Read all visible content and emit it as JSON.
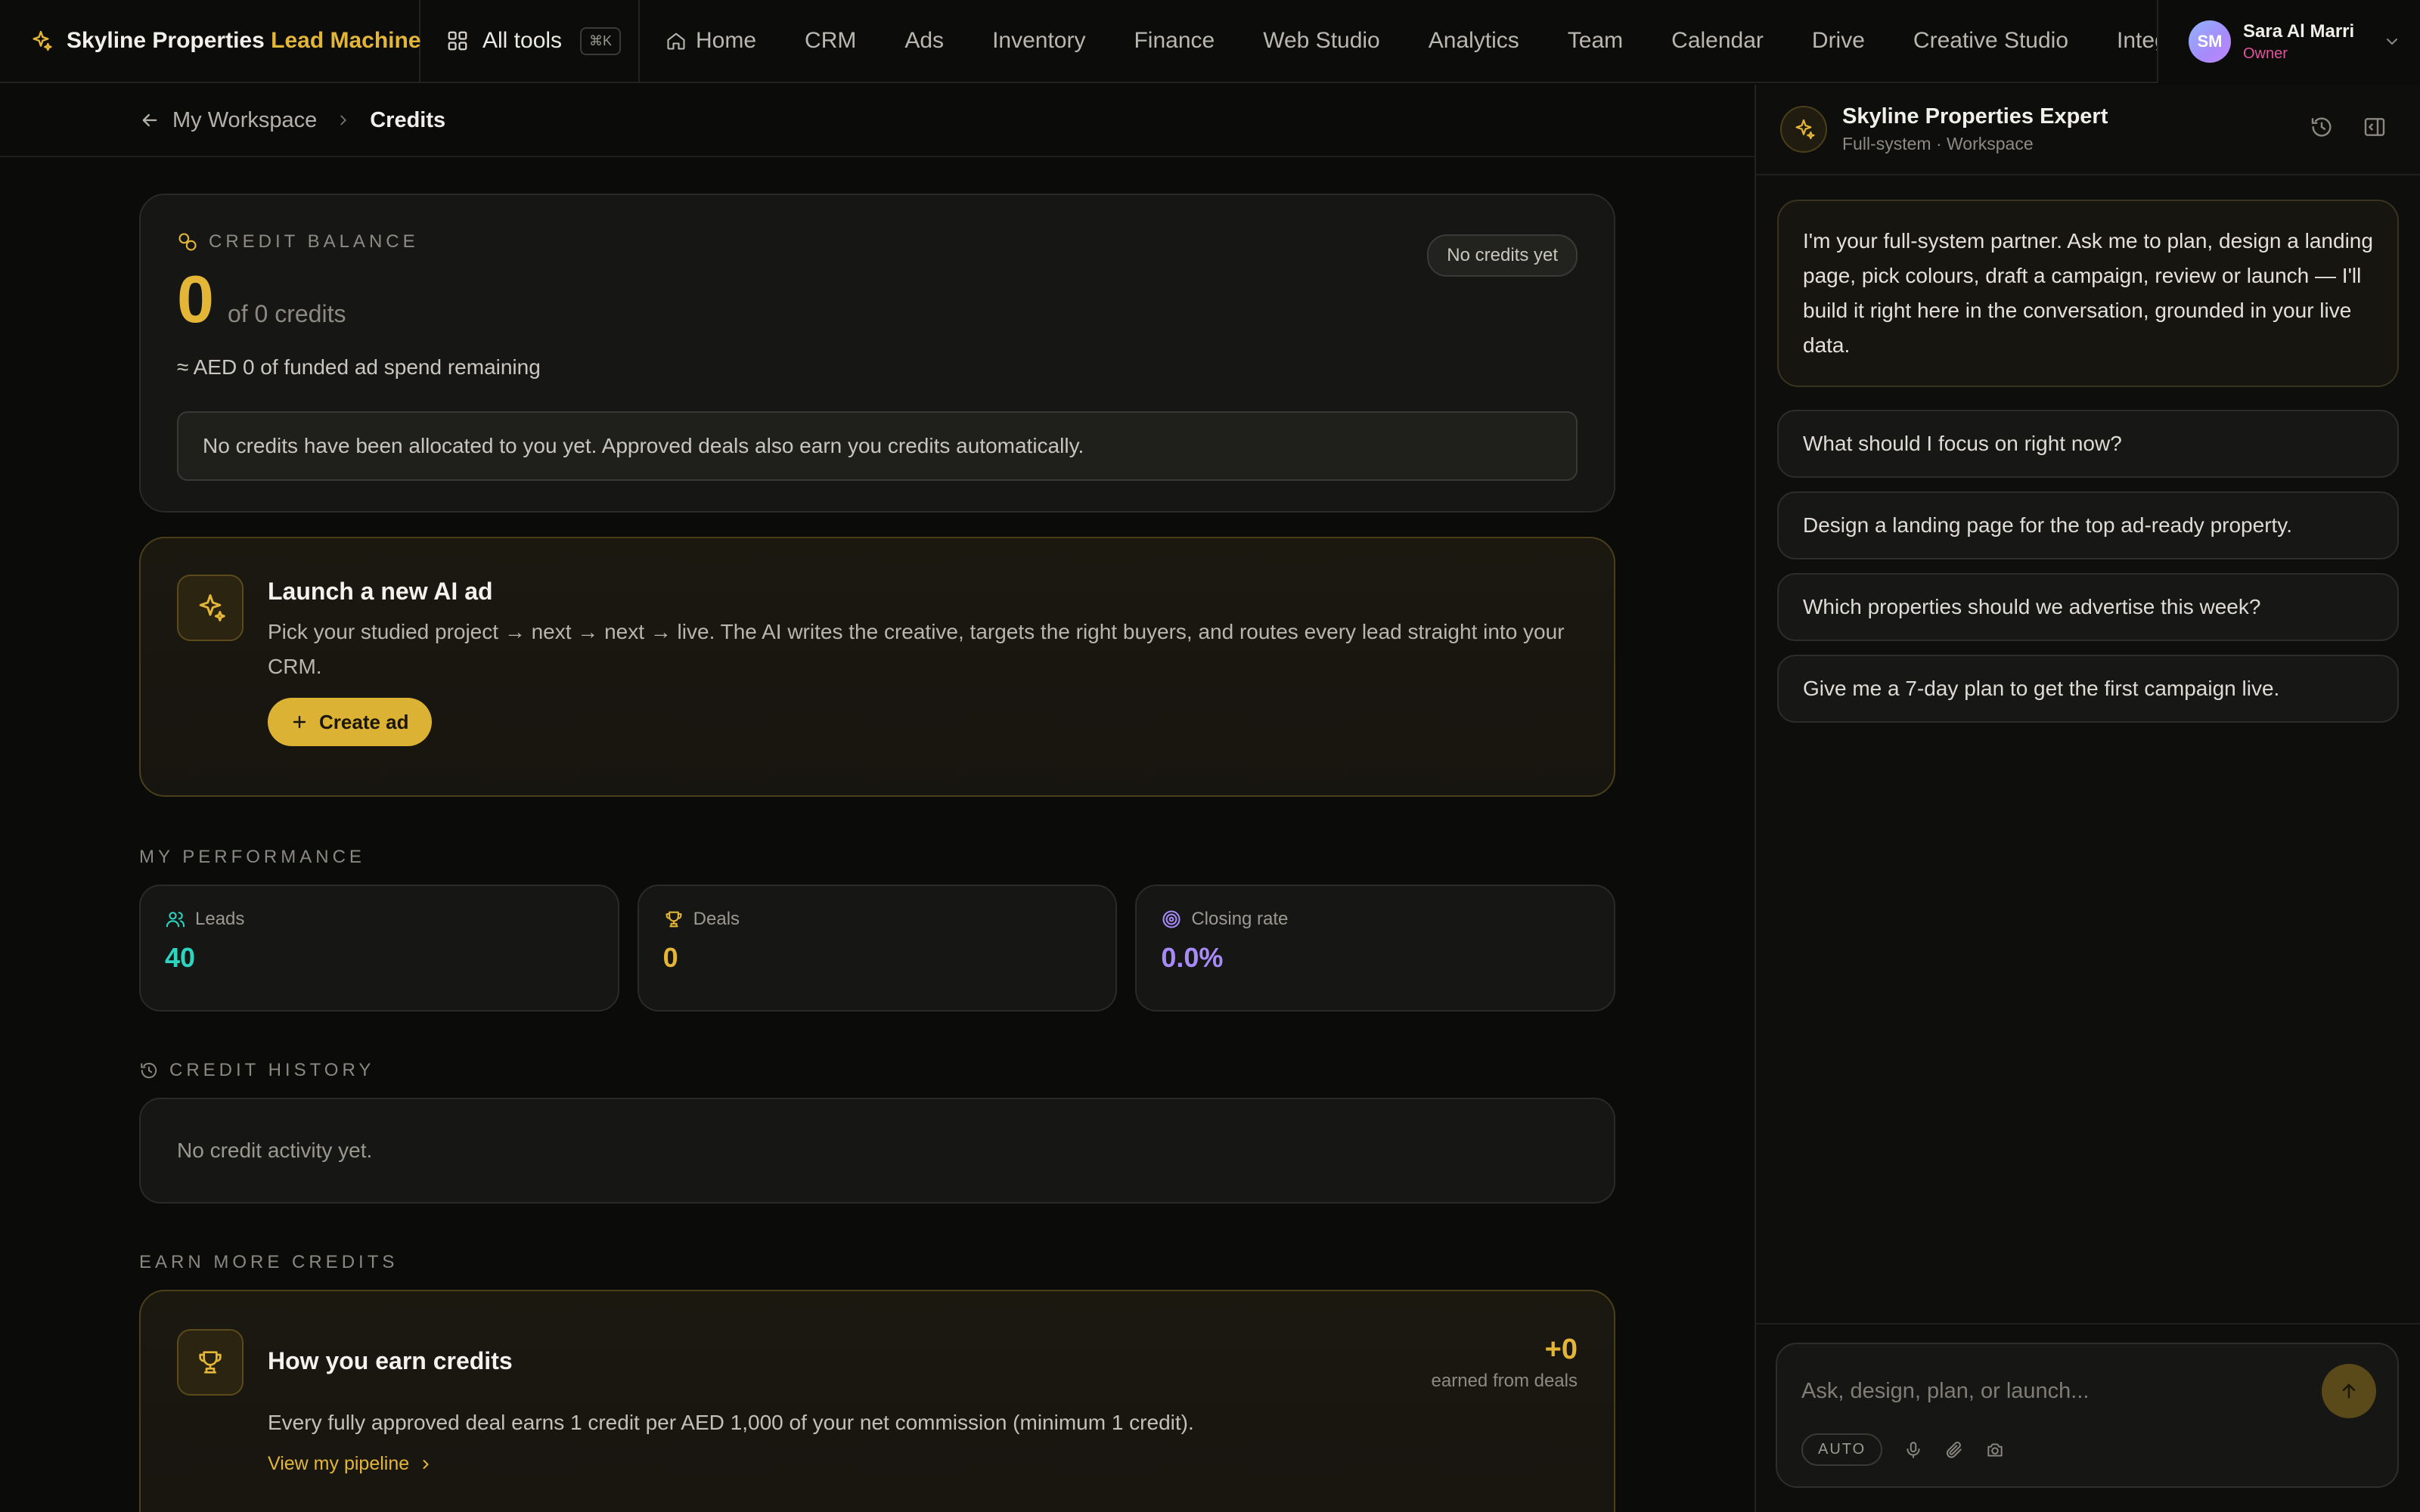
{
  "nav": {
    "brand_name": "Skyline Properties",
    "brand_accent": "Lead Machine",
    "all_tools": "All tools",
    "shortcut": "⌘K",
    "links": [
      "Home",
      "CRM",
      "Ads",
      "Inventory",
      "Finance",
      "Web Studio",
      "Analytics",
      "Team",
      "Calendar",
      "Drive",
      "Creative Studio",
      "Integrations"
    ],
    "user": {
      "initials": "SM",
      "name": "Sara Al Marri",
      "role": "Owner"
    }
  },
  "breadcrumb": {
    "parent": "My Workspace",
    "current": "Credits"
  },
  "balance": {
    "label": "CREDIT BALANCE",
    "value": "0",
    "of_text": "of 0 credits",
    "spend": "≈ AED 0 of funded ad spend remaining",
    "badge": "No credits yet",
    "notice": "No credits have been allocated to you yet. Approved deals also earn you credits automatically."
  },
  "launch": {
    "title": "Launch a new AI ad",
    "description": "Pick your studied project → next → next → live. The AI writes the creative, targets the right buyers, and routes every lead straight into your CRM.",
    "button": "Create ad"
  },
  "performance": {
    "label": "MY PERFORMANCE",
    "cards": [
      {
        "label": "Leads",
        "value": "40",
        "color": "#2dd4bf"
      },
      {
        "label": "Deals",
        "value": "0",
        "color": "#e3b638"
      },
      {
        "label": "Closing rate",
        "value": "0.0%",
        "color": "#a78bfa"
      }
    ]
  },
  "history": {
    "label": "CREDIT HISTORY",
    "empty": "No credit activity yet."
  },
  "earn": {
    "label": "EARN MORE CREDITS",
    "title": "How you earn credits",
    "stat_value": "+0",
    "stat_label": "earned from deals",
    "description": "Every fully approved deal earns 1 credit per AED 1,000 of your net commission (minimum 1 credit).",
    "link": "View my pipeline"
  },
  "assistant": {
    "title": "Skyline Properties Expert",
    "subtitle": "Full-system · Workspace",
    "intro": "I'm your full-system partner. Ask me to plan, design a landing page, pick colours, draft a campaign, review or launch — I'll build it right here in the conversation, grounded in your live data.",
    "suggestions": [
      "What should I focus on right now?",
      "Design a landing page for the top ad-ready property.",
      "Which properties should we advertise this week?",
      "Give me a 7-day plan to get the first campaign live."
    ],
    "input_placeholder": "Ask, design, plan, or launch...",
    "mode": "AUTO"
  },
  "colors": {
    "accent": "#e3b638",
    "leads": "#2dd4bf",
    "closing": "#a78bfa",
    "role": "#e0559b"
  }
}
